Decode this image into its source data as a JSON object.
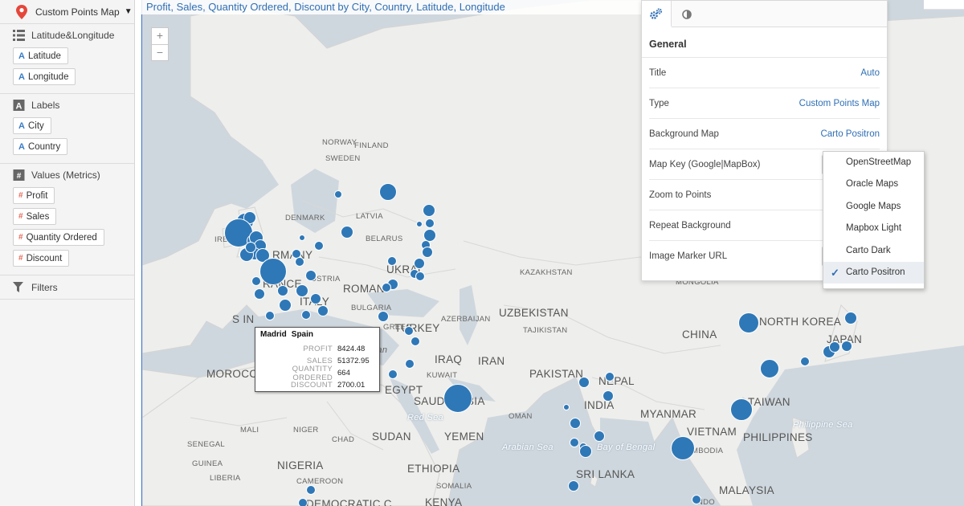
{
  "view_type": {
    "label": "Custom Points Map",
    "pin_color": "#e5463b"
  },
  "left_panel": {
    "sections": [
      {
        "title": "Latitude&Longitude",
        "icon": "list-icon",
        "pills": [
          {
            "type": "A",
            "label": "Latitude"
          },
          {
            "type": "A",
            "label": "Longitude"
          }
        ]
      },
      {
        "title": "Labels",
        "icon": "label-icon",
        "pills": [
          {
            "type": "A",
            "label": "City"
          },
          {
            "type": "A",
            "label": "Country"
          }
        ]
      },
      {
        "title": "Values (Metrics)",
        "icon": "hash-icon",
        "pills": [
          {
            "type": "#",
            "label": "Profit"
          },
          {
            "type": "#",
            "label": "Sales"
          },
          {
            "type": "#",
            "label": "Quantity Ordered"
          },
          {
            "type": "#",
            "label": "Discount"
          }
        ]
      }
    ],
    "filters_label": "Filters"
  },
  "map": {
    "title": "Profit, Sales, Quantity Ordered, Discount by City, Country, Latitude, Longitude",
    "zoom_in": "+",
    "zoom_out": "−",
    "point_color": "#2f78b7",
    "labels": {
      "norway": "NORWAY",
      "finland": "FINLAND",
      "sweden": "SWEDEN",
      "denmark": "DENMARK",
      "latvia": "LATVIA",
      "belarus": "BELARUS",
      "ireland": "IRELA",
      "germany": "RMANY",
      "austria": "USTRIA",
      "france": "RANCE",
      "romania": "ROMANI",
      "italy": "ITALY",
      "bulgaria": "BULGARIA",
      "ukraine": "UKRAI",
      "spain": "S IN",
      "greece": "GREEC",
      "turkey": "TURKEY",
      "azerbaijan": "AZERBAIJAN",
      "uzbekistan": "UZBEKISTAN",
      "tajikistan": "TAJIKISTAN",
      "kazakhstan": "KAZAKHSTAN",
      "mongolia": "MONGOLIA",
      "china": "CHINA",
      "north_korea": "NORTH KOREA",
      "japan": "JAPAN",
      "iraq": "IRAQ",
      "iran": "IRAN",
      "kuwait": "KUWAIT",
      "pakistan": "PAKISTAN",
      "nepal": "NEPAL",
      "india": "INDIA",
      "morocco": "MOROCCO",
      "egypt": "EGYPT",
      "saudi": "SAUDI.",
      "saudi2": "BIA",
      "oman": "OMAN",
      "myanmar": "MYANMAR",
      "taiwan": "TAIWAN",
      "vietnam": "VIETNAM",
      "philippines": "PHILIPPINES",
      "cambodia": "MBODIA",
      "mali": "MALI",
      "niger": "NIGER",
      "chad": "CHAD",
      "sudan": "SUDAN",
      "yemen": "YEMEN",
      "senegal": "SENEGAL",
      "guinea": "GUINEA",
      "nigeria": "NIGERIA",
      "ethiopia": "ETHIOPIA",
      "liberia": "LIBERIA",
      "cameroon": "CAMEROON",
      "somalia": "SOMALIA",
      "sri_lanka": "SRI LANKA",
      "malaysia": "MALAYSIA",
      "kenya": "KENYA",
      "congo": "DEMOCRATIC C",
      "red_sea": "Red Sea",
      "arabian_sea": "Arabian Sea",
      "bay_bengal": "Bay of Bengal",
      "philippine_sea": "Philippine Sea",
      "indo": "INDO",
      "ean": "ean"
    }
  },
  "tooltip": {
    "city": "Madrid",
    "country": "Spain",
    "rows": [
      {
        "key": "PROFIT",
        "value": "8424.48"
      },
      {
        "key": "SALES",
        "value": "51372.95"
      },
      {
        "key": "QUANTITY ORDERED",
        "value": "664"
      },
      {
        "key": "DISCOUNT",
        "value": "2700.01"
      }
    ]
  },
  "properties": {
    "group": "General",
    "rows": [
      {
        "label": "Title",
        "value": "Auto"
      },
      {
        "label": "Type",
        "value": "Custom Points Map"
      },
      {
        "label": "Background Map",
        "value": "Carto Positron"
      },
      {
        "label": "Map Key (Google|MapBox)",
        "value": ""
      },
      {
        "label": "Zoom to Points",
        "value": ""
      },
      {
        "label": "Repeat Background",
        "value": ""
      },
      {
        "label": "Image Marker URL",
        "value": ""
      }
    ]
  },
  "dropdown": {
    "options": [
      "OpenStreetMap",
      "Oracle Maps",
      "Google Maps",
      "Mapbox Light",
      "Carto Dark",
      "Carto Positron"
    ],
    "selected": "Carto Positron"
  }
}
